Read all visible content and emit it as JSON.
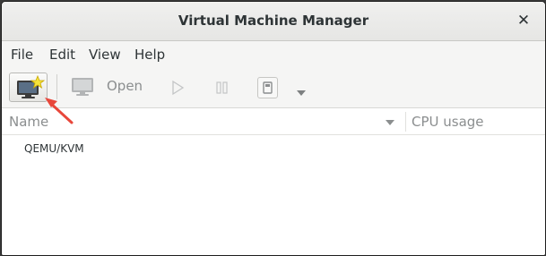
{
  "window": {
    "title": "Virtual Machine Manager",
    "close_icon": "close-icon"
  },
  "menu": {
    "items": [
      "File",
      "Edit",
      "View",
      "Help"
    ]
  },
  "toolbar": {
    "new_vm_icon": "new-vm-icon",
    "open_label": "Open",
    "run_icon": "play-icon",
    "pause_icon": "pause-icon",
    "shutdown_icon": "shutdown-icon",
    "dropdown_icon": "chevron-down-icon"
  },
  "list": {
    "columns": [
      "Name",
      "CPU usage"
    ],
    "rows": [
      {
        "name": "QEMU/KVM"
      }
    ]
  },
  "colors": {
    "annotation_arrow": "#e8473b",
    "disabled_text": "#8b8e8f"
  }
}
